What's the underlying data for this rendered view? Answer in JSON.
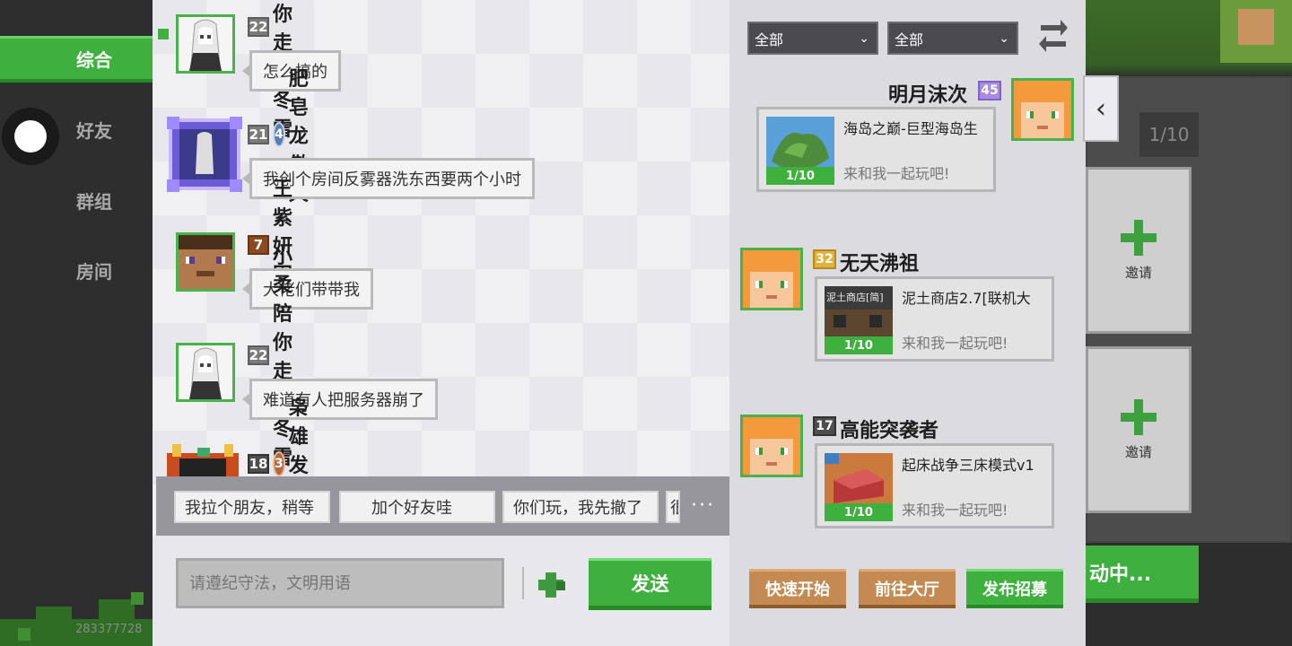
{
  "sidebar": {
    "items": [
      {
        "label": "综合",
        "active": true
      },
      {
        "label": "好友",
        "active": false
      },
      {
        "label": "群组",
        "active": false
      },
      {
        "label": "房间",
        "active": false
      }
    ],
    "uid_text": "283377728"
  },
  "chat": {
    "messages": [
      {
        "level": "22",
        "name": "小柔陪你走过冬雪",
        "text": "怎么搞的",
        "avatar": "anime-girl"
      },
      {
        "level": "21",
        "rank": "4",
        "name": "肥皂龙傲天",
        "text": "我创个房间反雾器洗东西要两个小时",
        "avatar": "framed-anime"
      },
      {
        "level": "7",
        "name": "王紫妍困了",
        "text": "大佬们带带我",
        "avatar": "steve"
      },
      {
        "level": "22",
        "name": "小柔陪你走过冬雪",
        "text": "难道有人把服务器崩了",
        "avatar": "anime-girl"
      },
      {
        "level": "18",
        "rank": "3",
        "name": "枭雄发芽二",
        "text": "",
        "avatar": "framed-gold"
      }
    ],
    "quick_replies": [
      "我拉个朋友，稍等",
      "加个好友哇",
      "你们玩，我先撤了",
      "很"
    ],
    "more_label": "···",
    "input_placeholder": "请遵纪守法，文明用语",
    "send_label": "发送"
  },
  "right": {
    "filter1": "全部",
    "filter2": "全部",
    "rooms": [
      {
        "player": "明月沫次",
        "level": "45",
        "room": "海岛之巅-巨型海岛生",
        "count": "1/10",
        "invite": "来和我一起玩吧!"
      },
      {
        "player": "无天沸祖",
        "level": "32",
        "room": "泥土商店2.7[联机大",
        "count": "1/10",
        "invite": "来和我一起玩吧!",
        "thumb_text": "泥土商店[简]"
      },
      {
        "player": "高能突袭者",
        "level": "17",
        "room": "起床战争三床模式v1",
        "count": "1/10",
        "invite": "来和我一起玩吧!"
      }
    ],
    "btn_quick": "快速开始",
    "btn_lobby": "前往大厅",
    "btn_recruit": "发布招募",
    "collapse_icon": "‹"
  },
  "background": {
    "count_text": "1/10",
    "invite_label": "邀请",
    "invite_label2": "邀请",
    "action_text": "动中..."
  },
  "colors": {
    "accent": "#3eb03e",
    "brown": "#c48a52",
    "panel": "#e8e8ec"
  }
}
